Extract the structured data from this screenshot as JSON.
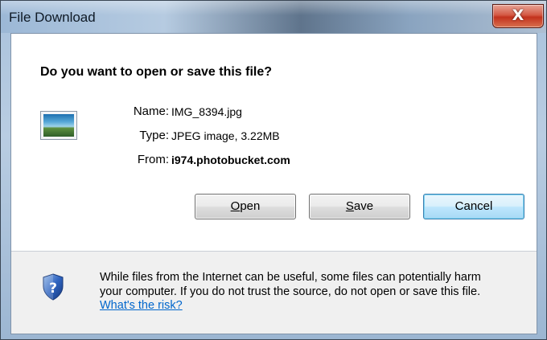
{
  "window": {
    "title": "File Download",
    "close_label": "X"
  },
  "dialog": {
    "question": "Do you want to open or save this file?",
    "file_icon": "jpeg-image-icon",
    "fields": {
      "name_label": "Name:",
      "name_value": "IMG_8394.jpg",
      "type_label": "Type:",
      "type_value": "JPEG image, 3.22MB",
      "from_label": "From:",
      "from_value": "i974.photobucket.com"
    },
    "buttons": {
      "open_mnemonic": "O",
      "open_rest": "pen",
      "save_mnemonic": "S",
      "save_rest": "ave",
      "cancel_label": "Cancel"
    }
  },
  "footer": {
    "icon": "shield-question-icon",
    "warning_line1": "While files from the Internet can be useful, some files can potentially harm",
    "warning_line2": "your computer. If you do not trust the source, do not open or save this file.",
    "risk_link": "What's the risk?"
  },
  "colors": {
    "link": "#0066cc",
    "close_button": "#c2311d",
    "default_button_border": "#3c7fb1"
  }
}
